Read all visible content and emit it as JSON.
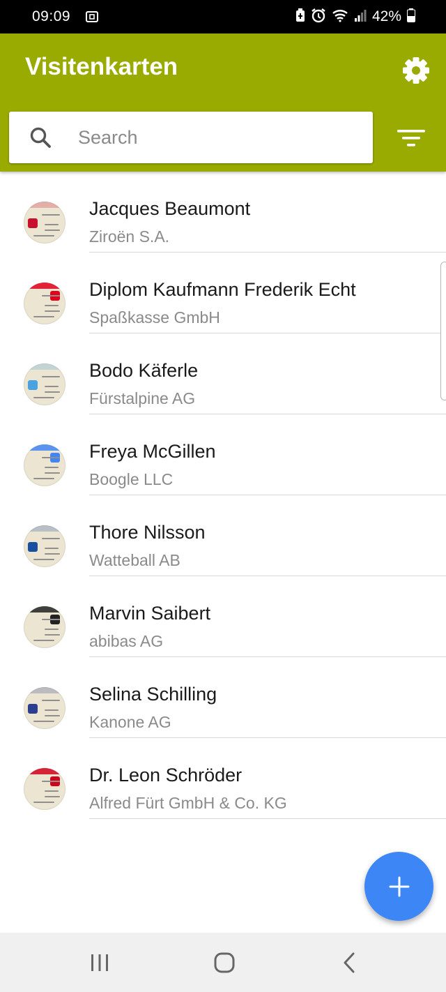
{
  "status_bar": {
    "time": "09:09",
    "battery": "42%",
    "icons": [
      "screenshot-icon",
      "battery-saver-icon",
      "alarm-icon",
      "wifi-icon",
      "signal-icon",
      "battery-icon"
    ]
  },
  "app_bar": {
    "title": "Visitenkarten",
    "settings_icon": "gear-icon",
    "color": "#9aab00"
  },
  "search": {
    "placeholder": "Search",
    "value": "",
    "filter_icon": "filter-icon"
  },
  "contacts": [
    {
      "name": "Jacques Beaumont",
      "company": "Ziroën S.A.",
      "accent": "#c8102e"
    },
    {
      "name": "Diplom Kaufmann Frederik Echt",
      "company": "Spaßkasse GmbH",
      "accent": "#e2001a"
    },
    {
      "name": "Bodo Käferle",
      "company": "Fürstalpine AG",
      "accent": "#4aa3df"
    },
    {
      "name": "Freya McGillen",
      "company": "Boogle LLC",
      "accent": "#4285f4"
    },
    {
      "name": "Thore Nilsson",
      "company": "Watteball AB",
      "accent": "#1a4fa0"
    },
    {
      "name": "Marvin Saibert",
      "company": "abibas AG",
      "accent": "#222222"
    },
    {
      "name": "Selina Schilling",
      "company": "Kanone AG",
      "accent": "#2c3e8f"
    },
    {
      "name": "Dr. Leon Schröder",
      "company": "Alfred Fürt GmbH & Co. KG",
      "accent": "#d0021b"
    }
  ],
  "fab": {
    "icon": "plus-icon",
    "color": "#3d86f5"
  },
  "nav_bar": {
    "icons": [
      "recents-icon",
      "home-icon",
      "back-icon"
    ]
  }
}
